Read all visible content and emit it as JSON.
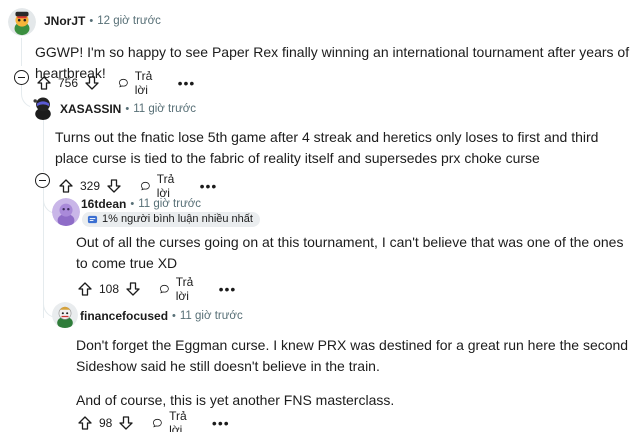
{
  "comments": [
    {
      "user": "JNorJT",
      "time": "12 giờ trước",
      "body": [
        "GGWP! I'm so happy to see Paper Rex finally winning an international tournament after years of heartbreak!"
      ],
      "votes": "756",
      "reply": "Trả lời"
    },
    {
      "user": "XASASSIN",
      "time": "11 giờ trước",
      "body": [
        "Turns out the fnatic lose 5th game after 4 streak and heretics only loses to first and third place curse is tied to the fabric of reality itself and supersedes prx choke curse"
      ],
      "votes": "329",
      "reply": "Trả lời"
    },
    {
      "user": "16tdean",
      "time": "11 giờ trước",
      "flair": "1% người bình luận nhiều nhất",
      "body": [
        "Out of all the curses going on at this tournament, I can't believe that was one of the ones to come true XD"
      ],
      "votes": "108",
      "reply": "Trả lời"
    },
    {
      "user": "financefocused",
      "time": "11 giờ trước",
      "body": [
        "Don't forget the Eggman curse. I knew PRX was destined for a great run here the second Sideshow said he still doesn't believe in the train.",
        "And of course, this is yet another FNS masterclass."
      ],
      "votes": "98",
      "reply": "Trả lời"
    }
  ],
  "dot": "•",
  "more_label": "•••"
}
